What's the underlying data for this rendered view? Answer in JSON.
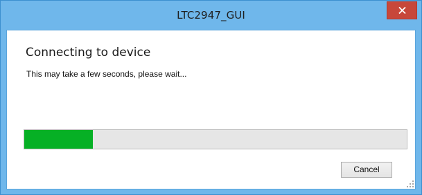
{
  "window": {
    "title": "LTC2947_GUI",
    "close_icon": "close-icon",
    "accent_color": "#6fb7eb",
    "close_color": "#c7473a"
  },
  "dialog": {
    "heading": "Connecting to device",
    "message": "This may take a few seconds, please wait...",
    "progress": {
      "value_percent": 18,
      "fill_color": "#06b025"
    },
    "cancel_label": "Cancel",
    "resize_grip_icon": "resize-grip-icon"
  }
}
